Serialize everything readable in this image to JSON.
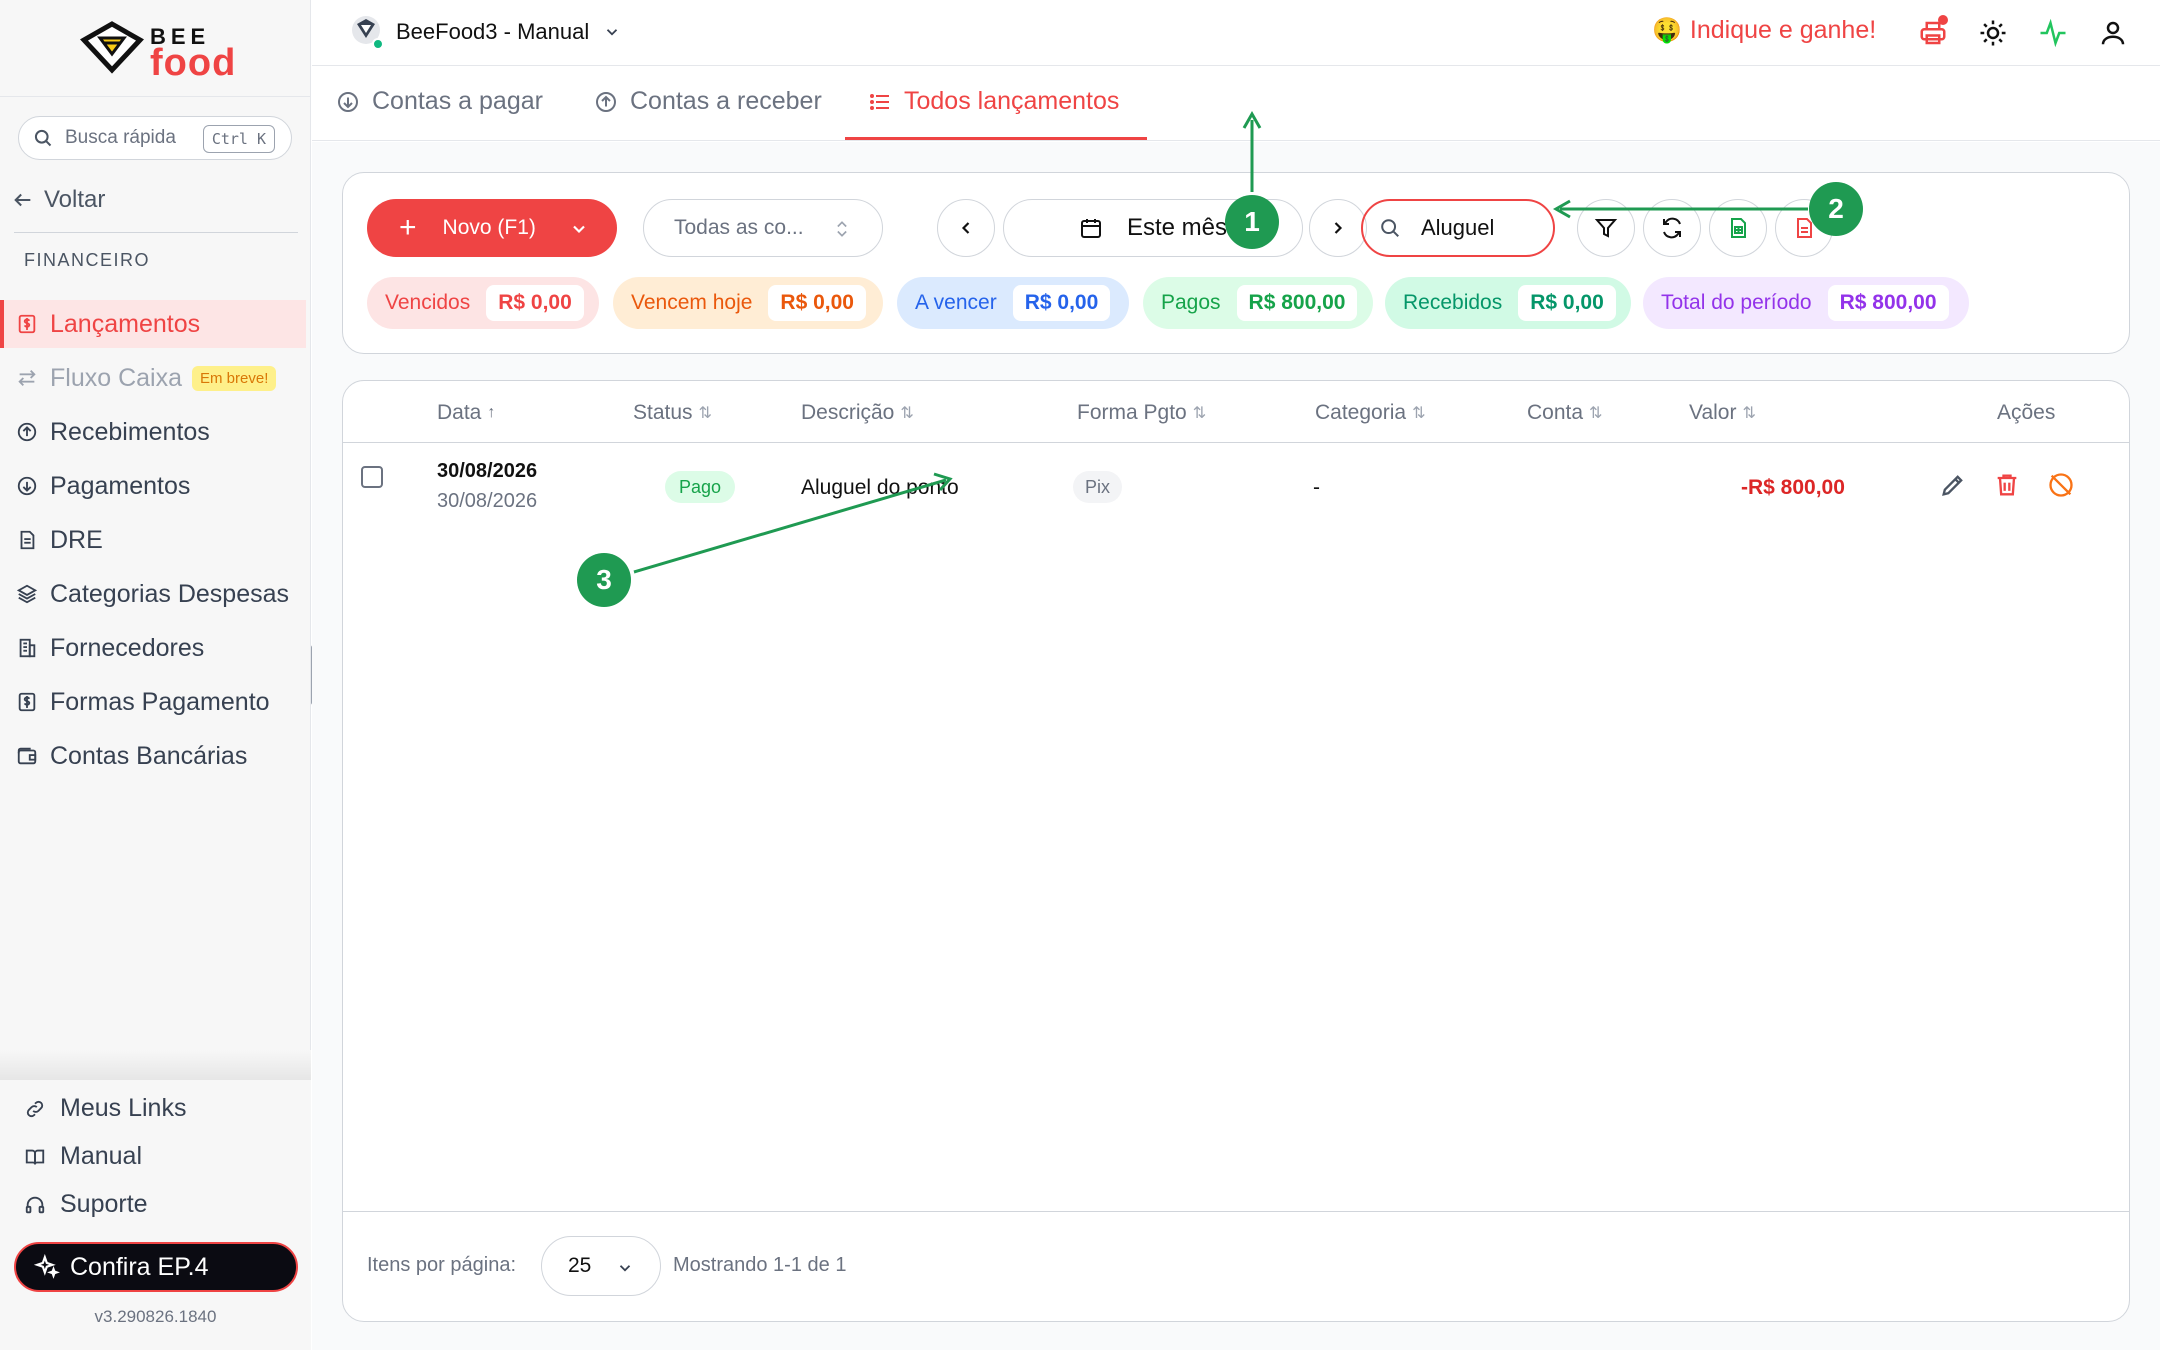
{
  "brand": {
    "logo_top": "BEE",
    "logo_bottom": "food"
  },
  "sidebar": {
    "search_label": "Busca rápida",
    "search_shortcut": "Ctrl K",
    "back_label": "Voltar",
    "section_label": "FINANCEIRO",
    "items": [
      {
        "label": "Lançamentos",
        "icon": "receipt-dollar-icon",
        "active": true
      },
      {
        "label": "Fluxo Caixa",
        "icon": "arrows-left-right-icon",
        "badge": "Em breve!"
      },
      {
        "label": "Recebimentos",
        "icon": "arrow-up-circle-icon"
      },
      {
        "label": "Pagamentos",
        "icon": "arrow-down-circle-icon"
      },
      {
        "label": "DRE",
        "icon": "document-icon"
      },
      {
        "label": "Categorias Despesas",
        "icon": "layers-icon"
      },
      {
        "label": "Fornecedores",
        "icon": "building-icon"
      },
      {
        "label": "Formas Pagamento",
        "icon": "receipt-dollar-icon"
      },
      {
        "label": "Contas Bancárias",
        "icon": "wallet-icon"
      }
    ],
    "bottom_links": [
      {
        "label": "Meus Links",
        "icon": "link-icon"
      },
      {
        "label": "Manual",
        "icon": "book-icon"
      },
      {
        "label": "Suporte",
        "icon": "headset-icon"
      }
    ],
    "cta_label": "Confira EP.4",
    "version": "v3.290826.1840"
  },
  "topbar": {
    "company": "BeeFood3 - Manual",
    "referral": "Indique e ganhe!",
    "referral_emoji": "🤑"
  },
  "tabs": [
    {
      "label": "Contas a pagar"
    },
    {
      "label": "Contas a receber"
    },
    {
      "label": "Todos lançamentos",
      "active": true
    }
  ],
  "toolbar": {
    "new_button": "Novo (F1)",
    "account_select": "Todas as co...",
    "period": "Este mês",
    "search_value": "Aluguel"
  },
  "summary": [
    {
      "label": "Vencidos",
      "value": "R$ 0,00"
    },
    {
      "label": "Vencem hoje",
      "value": "R$ 0,00"
    },
    {
      "label": "A vencer",
      "value": "R$ 0,00"
    },
    {
      "label": "Pagos",
      "value": "R$ 800,00"
    },
    {
      "label": "Recebidos",
      "value": "R$ 0,00"
    },
    {
      "label": "Total do período",
      "value": "R$ 800,00"
    }
  ],
  "table": {
    "columns": [
      "Data",
      "Status",
      "Descrição",
      "Forma Pgto",
      "Categoria",
      "Conta",
      "Valor",
      "Ações"
    ],
    "rows": [
      {
        "date": "30/08/2026",
        "date_sub": "30/08/2026",
        "status": "Pago",
        "description": "Aluguel do ponto",
        "payment": "Pix",
        "category": "-",
        "account": "",
        "value": "-R$ 800,00"
      }
    ]
  },
  "footer": {
    "per_page_label": "Itens por página:",
    "per_page_value": "25",
    "showing": "Mostrando 1-1 de 1"
  },
  "annotations": [
    "1",
    "2",
    "3"
  ],
  "colors": {
    "accent": "#ef4444",
    "annotation": "#1f9a52"
  }
}
